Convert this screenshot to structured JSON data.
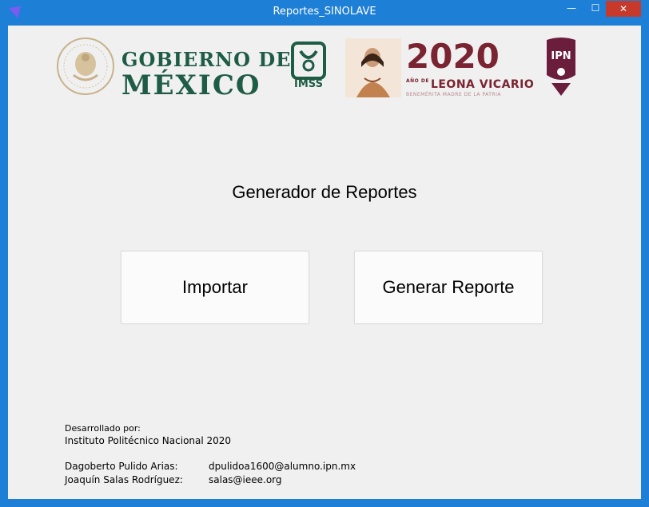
{
  "window": {
    "title": "Reportes_SINOLAVE",
    "minimize": "—",
    "maximize": "☐",
    "close": "✕"
  },
  "logos": {
    "gobierno_line1": "GOBIERNO DE",
    "gobierno_line2": "MÉXICO",
    "imss": "IMSS",
    "leona_year": "2020",
    "leona_small": "AÑO DE",
    "leona_name": "LEONA VICARIO",
    "leona_tagline": "BENEMÉRITA MADRE DE LA PATRIA",
    "ipn": "IPN",
    "colors": {
      "gobierno": "#1f5c46",
      "leona": "#7a2331"
    }
  },
  "main": {
    "heading": "Generador de Reportes",
    "import_label": "Importar",
    "report_label": "Generar Reporte"
  },
  "footer": {
    "developed_by": "Desarrollado por:",
    "institution": "Instituto Politécnico Nacional 2020",
    "developers": [
      {
        "name": "Dagoberto Pulido Arias:",
        "email": "dpulidoa1600@alumno.ipn.mx"
      },
      {
        "name": "Joaquín Salas Rodríguez:",
        "email": "salas@ieee.org"
      }
    ]
  }
}
